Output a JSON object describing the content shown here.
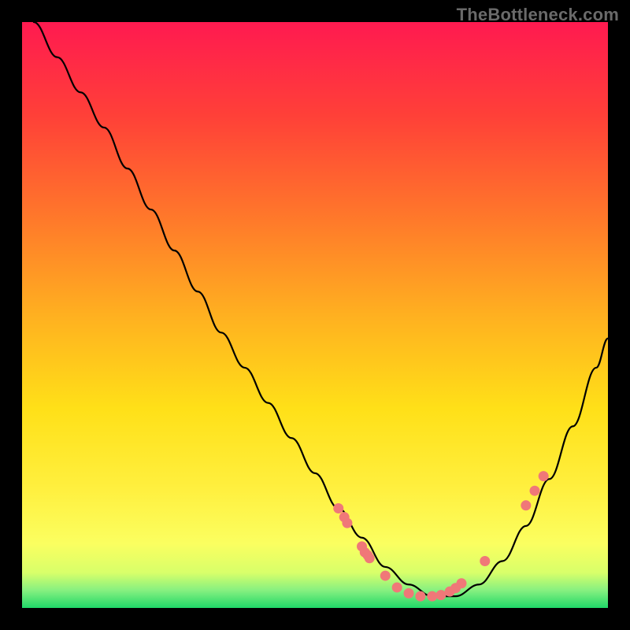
{
  "attribution": "TheBottleneck.com",
  "chart_data": {
    "type": "line",
    "title": "",
    "xlabel": "",
    "ylabel": "",
    "xlim": [
      0,
      100
    ],
    "ylim": [
      0,
      100
    ],
    "gradient_bands": [
      {
        "color": "#ff1a50",
        "from": 100,
        "to": 85
      },
      {
        "color": "#ff4a3a",
        "from": 85,
        "to": 70
      },
      {
        "color": "#ff8a2a",
        "from": 70,
        "to": 55
      },
      {
        "color": "#ffc020",
        "from": 55,
        "to": 40
      },
      {
        "color": "#ffe818",
        "from": 40,
        "to": 24
      },
      {
        "color": "#fff85a",
        "from": 24,
        "to": 12
      },
      {
        "color": "#d8ff6a",
        "from": 12,
        "to": 5
      },
      {
        "color": "#30e070",
        "from": 5,
        "to": 0
      }
    ],
    "series": [
      {
        "name": "bottleneck-curve",
        "x": [
          2,
          6,
          10,
          14,
          18,
          22,
          26,
          30,
          34,
          38,
          42,
          46,
          50,
          54,
          58,
          62,
          66,
          70,
          74,
          78,
          82,
          86,
          90,
          94,
          98,
          100
        ],
        "y": [
          100,
          94,
          88,
          82,
          75,
          68,
          61,
          54,
          47,
          41,
          35,
          29,
          23,
          17,
          12,
          7,
          4,
          2,
          2,
          4,
          8,
          14,
          22,
          31,
          41,
          46
        ]
      }
    ],
    "markers": [
      {
        "x": 54,
        "y": 17
      },
      {
        "x": 55,
        "y": 15.5
      },
      {
        "x": 55.5,
        "y": 14.5
      },
      {
        "x": 58,
        "y": 10.5
      },
      {
        "x": 58.5,
        "y": 9.5
      },
      {
        "x": 59,
        "y": 9
      },
      {
        "x": 59.3,
        "y": 8.5
      },
      {
        "x": 62,
        "y": 5.5
      },
      {
        "x": 64,
        "y": 3.5
      },
      {
        "x": 66,
        "y": 2.5
      },
      {
        "x": 68,
        "y": 2
      },
      {
        "x": 70,
        "y": 2
      },
      {
        "x": 71.5,
        "y": 2.2
      },
      {
        "x": 73,
        "y": 2.8
      },
      {
        "x": 74,
        "y": 3.4
      },
      {
        "x": 75,
        "y": 4.2
      },
      {
        "x": 79,
        "y": 8
      },
      {
        "x": 86,
        "y": 17.5
      },
      {
        "x": 87.5,
        "y": 20
      },
      {
        "x": 89,
        "y": 22.5
      }
    ]
  }
}
